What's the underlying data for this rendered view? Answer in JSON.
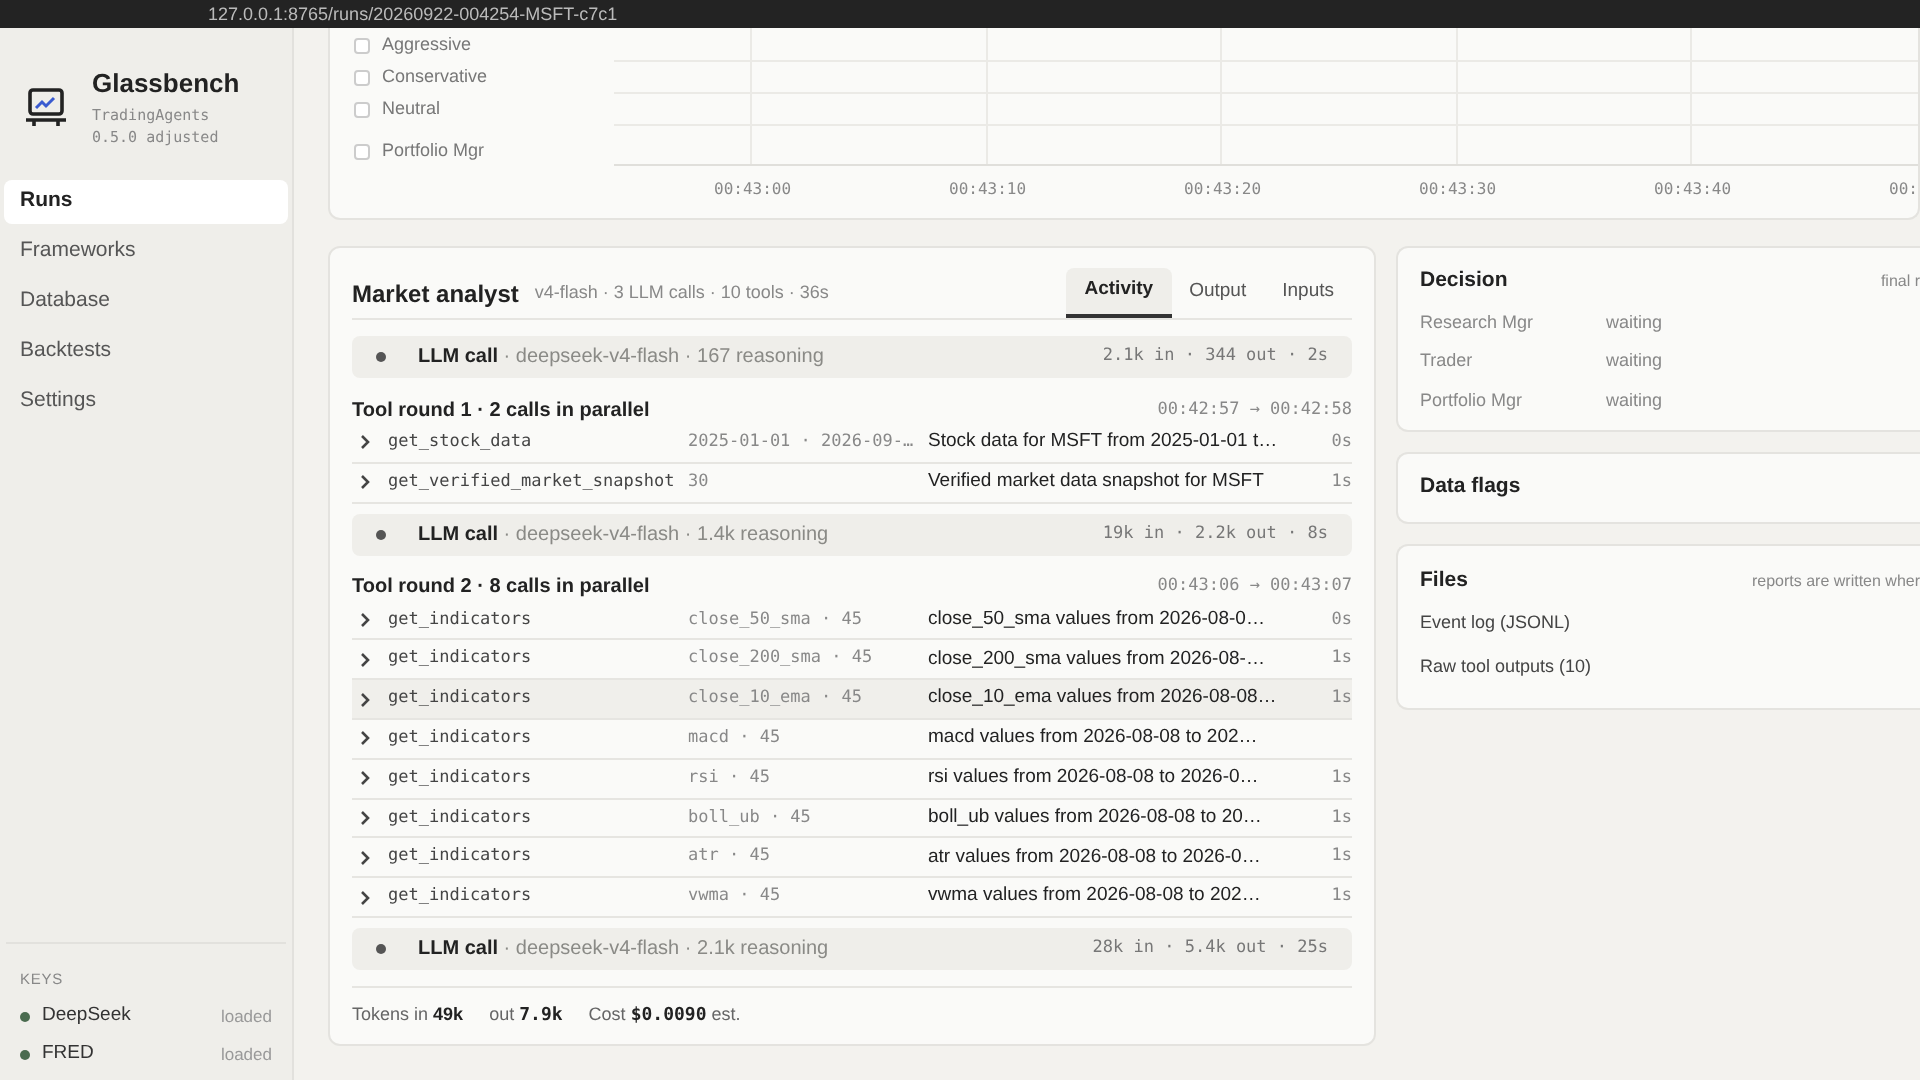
{
  "browser": {
    "url": "127.0.0.1:8765/runs/20260922-004254-MSFT-c7c1"
  },
  "sidebar": {
    "brand": {
      "title": "Glassbench",
      "subtitle": "TradingAgents",
      "version": "0.5.0 adjusted"
    },
    "items": [
      {
        "label": "Runs",
        "selected": true
      },
      {
        "label": "Frameworks",
        "selected": false
      },
      {
        "label": "Database",
        "selected": false
      },
      {
        "label": "Backtests",
        "selected": false
      },
      {
        "label": "Settings",
        "selected": false
      }
    ],
    "keys": {
      "title": "KEYS",
      "items": [
        {
          "name": "DeepSeek",
          "status": "loaded",
          "color": "#4a6b4f"
        },
        {
          "name": "FRED",
          "status": "loaded",
          "color": "#4a6b4f"
        }
      ]
    }
  },
  "timeline": {
    "rows": [
      {
        "label": "Aggressive",
        "checked": false
      },
      {
        "label": "Conservative",
        "checked": false
      },
      {
        "label": "Neutral",
        "checked": false
      },
      {
        "label": "Portfolio Mgr",
        "checked": false
      }
    ],
    "ticks": [
      "00:43:00",
      "00:43:10",
      "00:43:20",
      "00:43:30",
      "00:43:40",
      "00:"
    ]
  },
  "agent": {
    "title": "Market analyst",
    "meta": "v4-flash · 3 LLM calls · 10 tools · 36s",
    "tabs": [
      {
        "label": "Activity",
        "selected": true
      },
      {
        "label": "Output",
        "selected": false
      },
      {
        "label": "Inputs",
        "selected": false
      }
    ],
    "activity": [
      {
        "kind": "llm",
        "label": "LLM call",
        "detail": " · deepseek-v4-flash · 167 reasoning",
        "stats": "2.1k in · 344 out · 2s"
      },
      {
        "kind": "round",
        "title": "Tool round 1 · 2 calls in parallel",
        "time": "00:42:57 → 00:42:58",
        "calls": [
          {
            "tool": "get_stock_data",
            "args": "2025-01-01 · 2026-09-…",
            "summary": "Stock data for MSFT from 2025-01-01 t…",
            "duration": "0s",
            "hovered": false
          },
          {
            "tool": "get_verified_market_snapshot",
            "args": "30",
            "summary": "Verified market data snapshot for MSFT",
            "duration": "1s",
            "hovered": false
          }
        ]
      },
      {
        "kind": "llm",
        "label": "LLM call",
        "detail": " · deepseek-v4-flash · 1.4k reasoning",
        "stats": "19k in · 2.2k out · 8s"
      },
      {
        "kind": "round",
        "title": "Tool round 2 · 8 calls in parallel",
        "time": "00:43:06 → 00:43:07",
        "calls": [
          {
            "tool": "get_indicators",
            "args": "close_50_sma · 45",
            "summary": "close_50_sma values from 2026-08-0…",
            "duration": "0s",
            "hovered": false
          },
          {
            "tool": "get_indicators",
            "args": "close_200_sma · 45",
            "summary": "close_200_sma values from 2026-08-…",
            "duration": "1s",
            "hovered": false
          },
          {
            "tool": "get_indicators",
            "args": "close_10_ema · 45",
            "summary": "close_10_ema values from 2026-08-08…",
            "duration": "1s",
            "hovered": true
          },
          {
            "tool": "get_indicators",
            "args": "macd · 45",
            "summary": "macd values from 2026-08-08 to 202…",
            "hovered": false
          },
          {
            "tool": "get_indicators",
            "args": "rsi · 45",
            "summary": "rsi values from 2026-08-08 to 2026-0…",
            "duration": "1s",
            "hovered": false
          },
          {
            "tool": "get_indicators",
            "args": "boll_ub · 45",
            "summary": "boll_ub values from 2026-08-08 to 20…",
            "duration": "1s",
            "hovered": false
          },
          {
            "tool": "get_indicators",
            "args": "atr · 45",
            "summary": "atr values from 2026-08-08 to 2026-0…",
            "duration": "1s",
            "hovered": false
          },
          {
            "tool": "get_indicators",
            "args": "vwma · 45",
            "summary": "vwma values from 2026-08-08 to 202…",
            "duration": "1s",
            "hovered": false
          }
        ]
      },
      {
        "kind": "llm",
        "label": "LLM call",
        "detail": " · deepseek-v4-flash · 2.1k reasoning",
        "stats": "28k in · 5.4k out · 25s"
      }
    ],
    "totals": [
      {
        "label": "Tokens in",
        "value": "49k"
      },
      {
        "label": "out",
        "value": "7.9k"
      },
      {
        "label": "Cost",
        "value": "$0.0090",
        "suffix": "est."
      }
    ]
  },
  "decision": {
    "title": "Decision",
    "note": "final r",
    "rows": [
      {
        "role": "Research Mgr",
        "status": "waiting"
      },
      {
        "role": "Trader",
        "status": "waiting"
      },
      {
        "role": "Portfolio Mgr",
        "status": "waiting"
      }
    ]
  },
  "data_flags": {
    "title": "Data flags"
  },
  "files": {
    "title": "Files",
    "note": "reports are written wher",
    "items": [
      "Event log (JSONL)",
      "Raw tool outputs (10)"
    ]
  }
}
